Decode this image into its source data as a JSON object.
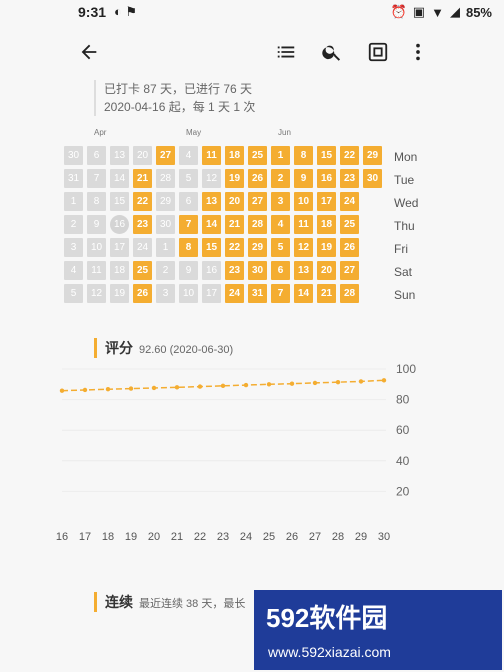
{
  "status": {
    "time": "9:31",
    "battery": "85%"
  },
  "toolbar": {},
  "info": {
    "line1": "已打卡 87 天，已进行 76 天",
    "line2": "2020-04-16 起，每 1 天 1 次"
  },
  "months": [
    "Apr",
    "May",
    "Jun"
  ],
  "weekdays": [
    "Mon",
    "Tue",
    "Wed",
    "Thu",
    "Fri",
    "Sat",
    "Sun"
  ],
  "heatmap": {
    "columns": [
      [
        "30",
        "31",
        "1",
        "2",
        "3",
        "4",
        "5"
      ],
      [
        "6",
        "7",
        "8",
        "9",
        "10",
        "11",
        "12"
      ],
      [
        "13",
        "14",
        "15",
        "16",
        "17",
        "18",
        "19"
      ],
      [
        "20",
        "21",
        "22",
        "23",
        "24",
        "25",
        "26"
      ],
      [
        "27",
        "28",
        "29",
        "30",
        "1",
        "2",
        "3"
      ],
      [
        "4",
        "5",
        "6",
        "7",
        "8",
        "9",
        "10"
      ],
      [
        "11",
        "12",
        "13",
        "14",
        "15",
        "16",
        "17"
      ],
      [
        "18",
        "19",
        "20",
        "21",
        "22",
        "23",
        "24"
      ],
      [
        "25",
        "26",
        "27",
        "28",
        "29",
        "30",
        "31"
      ],
      [
        "1",
        "2",
        "3",
        "4",
        "5",
        "6",
        "7"
      ],
      [
        "8",
        "9",
        "10",
        "11",
        "12",
        "13",
        "14"
      ],
      [
        "15",
        "16",
        "17",
        "18",
        "19",
        "20",
        "21"
      ],
      [
        "22",
        "23",
        "24",
        "25",
        "26",
        "27",
        "28"
      ],
      [
        "29",
        "30",
        "",
        "",
        "",
        "",
        ""
      ]
    ],
    "states": [
      [
        0,
        0,
        0,
        0,
        0,
        0,
        0
      ],
      [
        0,
        0,
        0,
        0,
        0,
        0,
        0
      ],
      [
        0,
        0,
        0,
        0,
        0,
        0,
        0
      ],
      [
        0,
        1,
        1,
        1,
        0,
        1,
        1
      ],
      [
        1,
        0,
        0,
        0,
        0,
        0,
        0
      ],
      [
        0,
        0,
        0,
        1,
        1,
        0,
        0
      ],
      [
        1,
        0,
        1,
        1,
        1,
        0,
        0
      ],
      [
        1,
        1,
        1,
        1,
        1,
        1,
        1
      ],
      [
        1,
        1,
        1,
        1,
        1,
        1,
        1
      ],
      [
        1,
        1,
        1,
        1,
        1,
        1,
        1
      ],
      [
        1,
        1,
        1,
        1,
        1,
        1,
        1
      ],
      [
        1,
        1,
        1,
        1,
        1,
        1,
        1
      ],
      [
        1,
        1,
        1,
        1,
        1,
        1,
        1
      ],
      [
        1,
        1,
        0,
        0,
        0,
        0,
        0
      ]
    ]
  },
  "score": {
    "title": "评分",
    "sub": "92.60 (2020-06-30)"
  },
  "chart_data": {
    "type": "line",
    "x": [
      "16",
      "17",
      "18",
      "19",
      "20",
      "21",
      "22",
      "23",
      "24",
      "25",
      "26",
      "27",
      "28",
      "29",
      "30"
    ],
    "values": [
      85.8,
      86.3,
      86.8,
      87.2,
      87.6,
      88.0,
      88.5,
      89.0,
      89.5,
      90.0,
      90.4,
      90.9,
      91.4,
      91.9,
      92.6
    ],
    "ylim": [
      0,
      100
    ],
    "yticks": [
      "100",
      "80",
      "60",
      "40",
      "20"
    ]
  },
  "streak": {
    "title": "连续",
    "sub": "最近连续 38 天，最长"
  },
  "watermark": {
    "brand": "592软件园",
    "url": "www.592xiazai.com"
  }
}
